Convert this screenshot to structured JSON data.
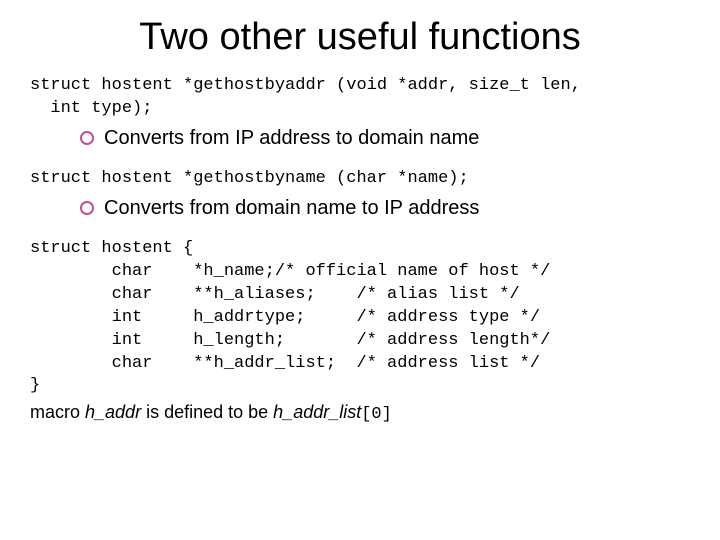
{
  "title": "Two other useful functions",
  "fn1_code": "struct hostent *gethostbyaddr (void *addr, size_t len,\n  int type);",
  "fn1_desc": "Converts from IP address to domain name",
  "fn2_code": "struct hostent *gethostbyname (char *name);",
  "fn2_desc": "Converts from domain name to IP address",
  "struct_code": "struct hostent {\n        char    *h_name;/* official name of host */\n        char    **h_aliases;    /* alias list */\n        int     h_addrtype;     /* address type */\n        int     h_length;       /* address length*/\n        char    **h_addr_list;  /* address list */\n}",
  "macro_pre": "macro ",
  "macro_haddr": "h_addr",
  "macro_mid": " is defined to be ",
  "macro_listpre": "h_addr_list",
  "macro_idx": "[0]"
}
